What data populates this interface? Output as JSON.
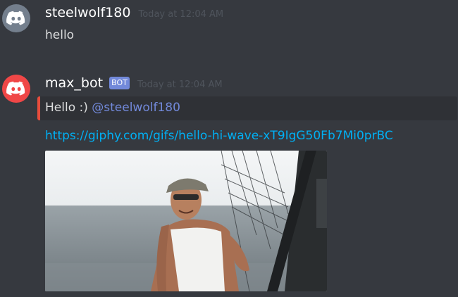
{
  "messages": [
    {
      "username": "steelwolf180",
      "timestamp": "Today at 12:04 AM",
      "content": "hello",
      "avatar_icon": "discord-logo-icon",
      "avatar_color": "#747f8d"
    },
    {
      "username": "max_bot",
      "bot_tag": "BOT",
      "timestamp": "Today at 12:04 AM",
      "embed_text": "Hello :)",
      "embed_mention": "@steelwolf180",
      "link": "https://giphy.com/gifs/hello-hi-wave-xT9IgG50Fb7Mi0prBC",
      "avatar_icon": "discord-logo-icon",
      "avatar_color": "#f04747",
      "embed_accent": "#e74c3c",
      "bot_tag_color": "#7289da"
    }
  ]
}
